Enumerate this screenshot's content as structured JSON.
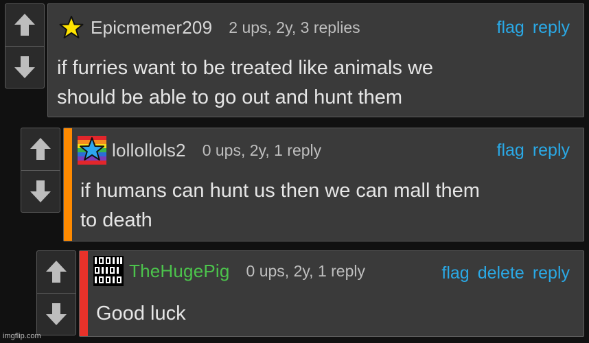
{
  "comments": [
    {
      "username": "Epicmemer209",
      "stats": "2 ups, 2y, 3 replies",
      "actions": [
        "flag",
        "reply"
      ],
      "text_lines": [
        "if furries want to be treated like animals we",
        "should be able to go out and hunt them"
      ],
      "username_color": "#d7d7d7",
      "avatar_icon": "yellow-star-icon"
    },
    {
      "username": "lollollols2",
      "stats": "0 ups, 2y, 1 reply",
      "actions": [
        "flag",
        "reply"
      ],
      "text_lines": [
        "if humans can hunt us then we can mall them",
        "to death"
      ],
      "stripe_color": "#ff8a00",
      "username_color": "#d7d7d7",
      "avatar_icon": "rainbow-star-icon"
    },
    {
      "username": "TheHugePig",
      "stats": "0 ups, 2y, 1 reply",
      "actions": [
        "flag",
        "delete",
        "reply"
      ],
      "text_lines": [
        "Good luck"
      ],
      "stripe_color": "#e8322a",
      "username_color": "#4cc44c",
      "avatar_icon": "binary-pattern-icon"
    }
  ],
  "watermark": "imgflip.com",
  "accent_color": "#2aa9e6"
}
